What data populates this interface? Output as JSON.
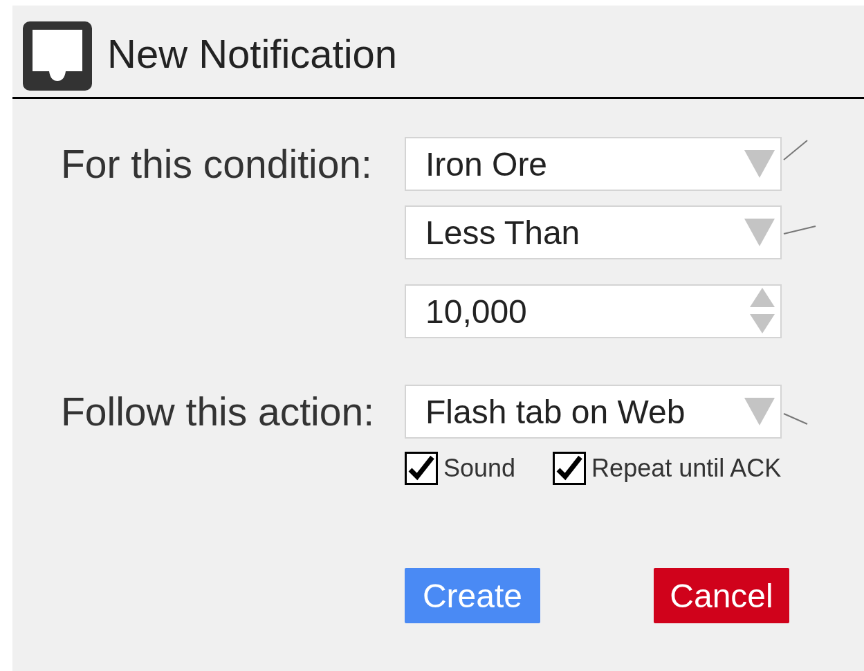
{
  "title": "New Notification",
  "condition": {
    "label": "For this condition:",
    "fields": [
      {
        "kind": "select",
        "value": "Iron Ore"
      },
      {
        "kind": "select",
        "value": "Less Than"
      },
      {
        "kind": "number",
        "value": "10,000"
      }
    ]
  },
  "action": {
    "label": "Follow this action:",
    "field": {
      "kind": "select",
      "value": "Flash tab on Web"
    },
    "options": [
      {
        "label": "Sound",
        "checked": true
      },
      {
        "label": "Repeat until ACK",
        "checked": true
      }
    ]
  },
  "buttons": [
    {
      "label": "Create",
      "kind": "primary"
    },
    {
      "label": "Cancel",
      "kind": "danger"
    }
  ]
}
